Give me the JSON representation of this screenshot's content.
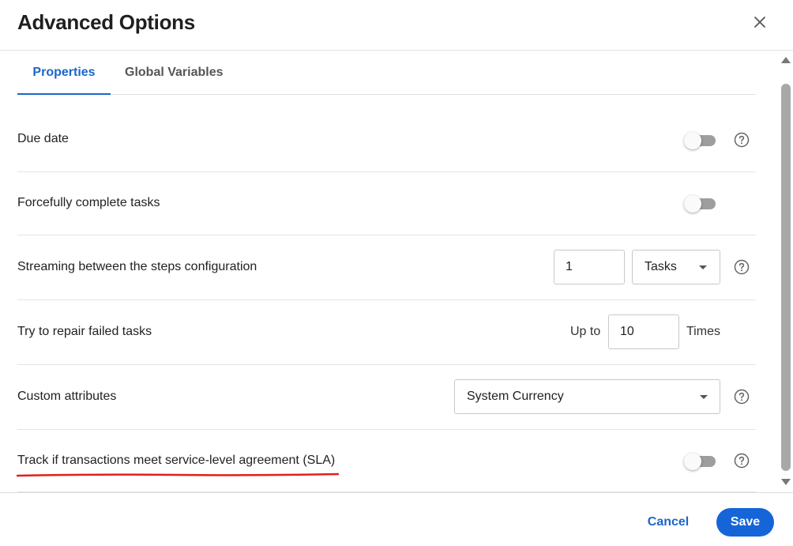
{
  "dialog": {
    "title": "Advanced Options",
    "close_icon": "close-icon"
  },
  "tabs": [
    {
      "label": "Properties",
      "active": true
    },
    {
      "label": "Global Variables",
      "active": false
    }
  ],
  "rows": {
    "due_date": {
      "label": "Due date",
      "toggle_on": false,
      "help_icon": "help-circle-icon"
    },
    "force_complete": {
      "label": "Forcefully complete tasks",
      "toggle_on": false
    },
    "streaming": {
      "label": "Streaming between the steps configuration",
      "count_value": "1",
      "unit_selected": "Tasks",
      "help_icon": "help-circle-icon"
    },
    "repair": {
      "label": "Try to repair failed tasks",
      "prefix": "Up to",
      "times_value": "10",
      "suffix": "Times"
    },
    "custom_attrs": {
      "label": "Custom attributes",
      "selected": "System Currency",
      "help_icon": "help-circle-icon"
    },
    "sla": {
      "label": "Track if transactions meet service-level agreement (SLA)",
      "toggle_on": false,
      "help_icon": "help-circle-icon",
      "annotation": "red-underline"
    }
  },
  "footer": {
    "cancel_label": "Cancel",
    "save_label": "Save"
  },
  "colors": {
    "accent": "#1a66cc",
    "save_button": "#1565d8",
    "annotation": "#e0201c"
  }
}
